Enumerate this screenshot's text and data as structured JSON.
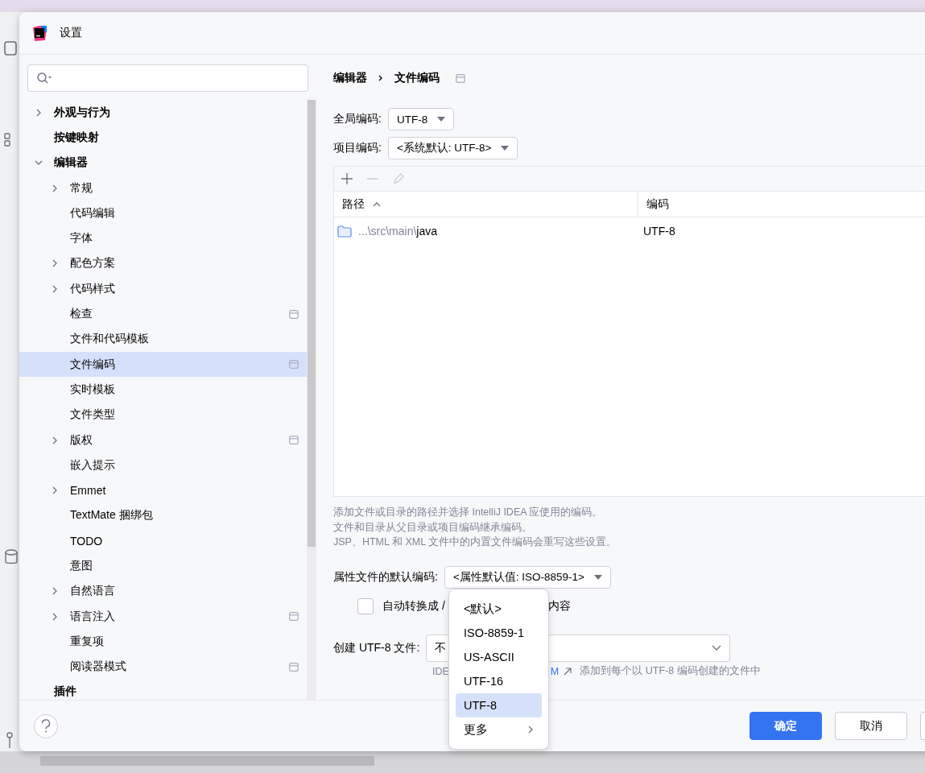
{
  "window": {
    "title": "设置"
  },
  "tree": [
    {
      "label": "外观与行为",
      "expanded": false
    },
    {
      "label": "按键映射"
    },
    {
      "label": "编辑器",
      "expanded": true,
      "children": [
        {
          "label": "常规",
          "expanded": false,
          "selected": false
        },
        {
          "label": "代码编辑",
          "selected": false
        },
        {
          "label": "字体",
          "selected": false
        },
        {
          "label": "配色方案",
          "expanded": false,
          "selected": false
        },
        {
          "label": "代码样式",
          "expanded": false,
          "selected": false
        },
        {
          "label": "检查",
          "scope_icon": true,
          "selected": false
        },
        {
          "label": "文件和代码模板",
          "selected": false
        },
        {
          "label": "文件编码",
          "scope_icon": true,
          "selected": true
        },
        {
          "label": "实时模板",
          "selected": false
        },
        {
          "label": "文件类型",
          "selected": false
        },
        {
          "label": "版权",
          "expanded": false,
          "scope_icon": true,
          "selected": false
        },
        {
          "label": "嵌入提示",
          "selected": false
        },
        {
          "label": "Emmet",
          "expanded": false,
          "selected": false
        },
        {
          "label": "TextMate 捆绑包",
          "selected": false
        },
        {
          "label": "TODO",
          "selected": false
        },
        {
          "label": "意图",
          "selected": false
        },
        {
          "label": "自然语言",
          "expanded": false,
          "selected": false
        },
        {
          "label": "语言注入",
          "expanded": false,
          "scope_icon": true,
          "selected": false
        },
        {
          "label": "重复项",
          "selected": false
        },
        {
          "label": "阅读器模式",
          "scope_icon": true,
          "selected": false
        }
      ]
    },
    {
      "label": "插件"
    }
  ],
  "breadcrumb": [
    "编辑器",
    "文件编码"
  ],
  "global_encoding": {
    "label": "全局编码:",
    "value": "UTF-8"
  },
  "project_encoding": {
    "label": "项目编码:",
    "value": "<系统默认: UTF-8>"
  },
  "table": {
    "columns": [
      {
        "label": "路径",
        "sort_ascending": true
      },
      {
        "label": "编码"
      }
    ],
    "rows": [
      {
        "path_prefix": "...\\src\\main\\",
        "path_name": "java",
        "encoding": "UTF-8"
      }
    ]
  },
  "help_lines": [
    "添加文件或目录的路径并选择 IntelliJ IDEA 应使用的编码。",
    "文件和目录从父目录或项目编码继承编码。",
    "JSP、HTML 和 XML 文件中的内置文件编码会重写这些设置。"
  ],
  "properties_encoding": {
    "label": "属性文件的默认编码:",
    "value": "<属性默认值: ISO-8859-1>"
  },
  "native_to_ascii": {
    "label_start": "自动转换成 /",
    "label_end": "内容",
    "checked": false
  },
  "create_utf8": {
    "label": "创建 UTF-8 文件:",
    "value": "不",
    "hint_start": "IDE",
    "hint_link": "M",
    "hint_end": "添加到每个以 UTF-8 编码创建的文件中"
  },
  "popup": {
    "items": [
      {
        "label": "<默认>",
        "selected": false
      },
      {
        "label": "ISO-8859-1",
        "selected": false
      },
      {
        "label": "US-ASCII",
        "selected": false
      },
      {
        "label": "UTF-16",
        "selected": false
      },
      {
        "label": "UTF-8",
        "selected": true
      },
      {
        "label": "更多",
        "selected": false,
        "submenu": true
      }
    ]
  },
  "buttons": [
    {
      "label": "确定",
      "kind": "primary"
    },
    {
      "label": "取消",
      "kind": "secondary"
    }
  ]
}
